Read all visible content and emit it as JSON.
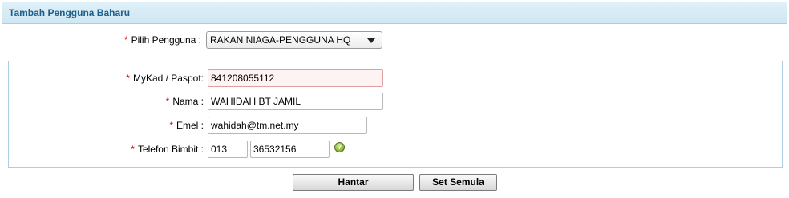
{
  "panel": {
    "title": "Tambah Pengguna Baharu"
  },
  "user_select": {
    "required_mark": "*",
    "label": "Pilih Pengguna :",
    "selected": "RAKAN NIAGA-PENGGUNA HQ"
  },
  "form": {
    "mykad": {
      "required_mark": "*",
      "label": "MyKad / Paspot:",
      "value": "841208055112"
    },
    "nama": {
      "required_mark": "*",
      "label": "Nama :",
      "value": "WAHIDAH BT JAMIL"
    },
    "emel": {
      "required_mark": "*",
      "label": "Emel :",
      "value": "wahidah@tm.net.my"
    },
    "telefon": {
      "required_mark": "*",
      "label": "Telefon Bimbit :",
      "prefix": "013",
      "number": "36532156",
      "help_icon_glyph": "?"
    }
  },
  "buttons": {
    "submit": "Hantar",
    "reset": "Set Semula"
  },
  "colors": {
    "header_text": "#1f5f8b",
    "border": "#a9cfe0",
    "required": "#d80000"
  }
}
